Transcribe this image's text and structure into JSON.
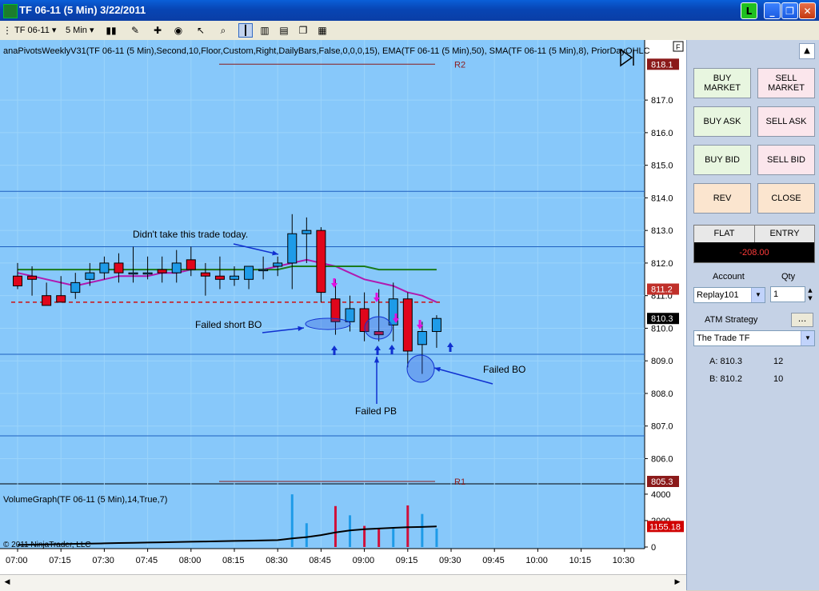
{
  "window": {
    "title": "TF 06-11 (5 Min)  3/22/2011",
    "minimize": "_",
    "restore": "❐",
    "close": "✕",
    "status_btn": "L"
  },
  "toolbar": {
    "instrument": "TF 06-11",
    "interval": "5 Min"
  },
  "chart": {
    "indicator_text": "anaPivotsWeeklyV31(TF 06-11 (5 Min),Second,10,Floor,Custom,Right,DailyBars,False,0,0,0,15), EMA(TF 06-11 (5 Min),50), SMA(TF 06-11 (5 Min),8), PriorDayOHLC",
    "volume_label": "VolumeGraph(TF 06-11 (5 Min),14,True,7)",
    "copyright": "© 2011 NinjaTrader, LLC",
    "panel_flag": "F",
    "price_ticks": [
      "817.0",
      "816.0",
      "815.0",
      "814.0",
      "813.0",
      "812.0",
      "811.0",
      "810.0",
      "809.0",
      "808.0",
      "807.0",
      "806.0"
    ],
    "price_markers": [
      {
        "text": "818.1",
        "color": "#8b1a1a"
      },
      {
        "text": "811.2",
        "color": "#c0302a"
      },
      {
        "text": "810.3",
        "color": "#000000"
      },
      {
        "text": "805.3",
        "color": "#8b1a1a"
      }
    ],
    "volume_ticks": [
      "4000",
      "2000",
      "0"
    ],
    "volume_marker": "1155.18",
    "time_ticks": [
      "07:00",
      "07:15",
      "07:30",
      "07:45",
      "08:00",
      "08:15",
      "08:30",
      "08:45",
      "09:00",
      "09:15",
      "09:30",
      "09:45",
      "10:00",
      "10:15",
      "10:30"
    ],
    "pivots": [
      "R2",
      "R1"
    ],
    "annotations": [
      {
        "text": "Didn't take this trade today."
      },
      {
        "text": "Failed short BO"
      },
      {
        "text": "Failed PB"
      },
      {
        "text": "Failed BO"
      }
    ],
    "colors": {
      "background": "#87c8fa",
      "up": "#1e9be8",
      "down": "#e0061b",
      "ema": "#1a7a1a",
      "sma": "#b01ab0",
      "pivot_line": "#8b1a1a",
      "level_line": "#1e5fc0"
    }
  },
  "chart_data": {
    "type": "candlestick",
    "x": [
      "07:00",
      "07:05",
      "07:10",
      "07:15",
      "07:20",
      "07:25",
      "07:30",
      "07:35",
      "07:40",
      "07:45",
      "07:50",
      "07:55",
      "08:00",
      "08:05",
      "08:10",
      "08:15",
      "08:20",
      "08:25",
      "08:30",
      "08:35",
      "08:40",
      "08:45",
      "08:50",
      "08:55",
      "09:00",
      "09:05",
      "09:10",
      "09:15",
      "09:20",
      "09:25"
    ],
    "open": [
      811.6,
      811.6,
      811.0,
      811.0,
      811.1,
      811.5,
      811.7,
      812.0,
      811.7,
      811.7,
      811.8,
      811.7,
      812.1,
      811.7,
      811.6,
      811.5,
      811.5,
      811.8,
      811.9,
      812.0,
      812.9,
      813.0,
      810.9,
      810.2,
      810.6,
      809.9,
      810.1,
      810.9,
      809.5,
      809.9
    ],
    "high": [
      812.0,
      811.9,
      811.4,
      811.6,
      811.7,
      812.0,
      812.2,
      812.3,
      812.5,
      812.2,
      812.2,
      812.4,
      812.5,
      812.0,
      812.2,
      811.9,
      811.9,
      812.2,
      812.2,
      813.5,
      813.4,
      813.1,
      811.5,
      811.0,
      811.1,
      811.2,
      811.4,
      811.1,
      810.2,
      810.4
    ],
    "low": [
      811.2,
      811.0,
      810.7,
      810.8,
      810.9,
      811.3,
      811.5,
      811.4,
      811.4,
      811.5,
      811.4,
      811.4,
      811.6,
      811.0,
      811.2,
      811.3,
      811.2,
      811.5,
      811.6,
      811.2,
      812.0,
      810.8,
      809.8,
      809.9,
      809.6,
      809.6,
      809.6,
      808.8,
      808.6,
      809.4
    ],
    "close": [
      811.3,
      811.5,
      810.7,
      810.8,
      811.4,
      811.7,
      812.0,
      811.7,
      811.7,
      811.7,
      811.7,
      812.0,
      811.8,
      811.6,
      811.5,
      811.6,
      811.9,
      811.8,
      812.0,
      812.9,
      813.0,
      811.1,
      810.2,
      810.6,
      809.9,
      809.8,
      810.9,
      809.3,
      809.9,
      810.3
    ],
    "ema50": [
      811.8,
      811.8,
      811.8,
      811.8,
      811.8,
      811.8,
      811.8,
      811.8,
      811.8,
      811.8,
      811.8,
      811.8,
      811.8,
      811.8,
      811.8,
      811.8,
      811.8,
      811.8,
      811.8,
      811.9,
      811.9,
      811.9,
      811.9,
      811.9,
      811.9,
      811.8,
      811.8,
      811.8,
      811.8,
      811.8
    ],
    "sma8": [
      811.7,
      811.6,
      811.5,
      811.4,
      811.3,
      811.4,
      811.5,
      811.6,
      811.6,
      811.6,
      811.7,
      811.7,
      811.8,
      811.8,
      811.8,
      811.8,
      811.8,
      811.8,
      811.9,
      812.0,
      812.1,
      812.0,
      811.9,
      811.7,
      811.5,
      811.4,
      811.3,
      811.1,
      811.0,
      810.8
    ],
    "volume": [
      0,
      0,
      0,
      0,
      0,
      0,
      0,
      0,
      0,
      0,
      0,
      0,
      0,
      0,
      0,
      0,
      0,
      0,
      0,
      3990,
      1800,
      0,
      3100,
      2400,
      1600,
      1400,
      1500,
      3150,
      2500,
      1400
    ],
    "volume_avg": [
      160,
      180,
      200,
      220,
      240,
      260,
      280,
      300,
      320,
      340,
      360,
      380,
      400,
      420,
      440,
      460,
      480,
      500,
      520,
      650,
      750,
      900,
      1100,
      1250,
      1350,
      1400,
      1450,
      1500,
      1520,
      1555
    ],
    "ylim": [
      805.3,
      818.5
    ],
    "volume_ylim": [
      0,
      4600
    ],
    "pivot_levels": [
      {
        "name": "R2",
        "value": 818.1
      },
      {
        "name": "R1",
        "value": 805.3
      }
    ],
    "level_lines": [
      814.2,
      812.5,
      809.2,
      806.7
    ],
    "prior_close": 810.8,
    "grid": true
  },
  "panel": {
    "buttons": [
      {
        "label": "BUY\nMARKET",
        "kind": "buy"
      },
      {
        "label": "SELL\nMARKET",
        "kind": "sell"
      },
      {
        "label": "BUY ASK",
        "kind": "buy"
      },
      {
        "label": "SELL ASK",
        "kind": "sell"
      },
      {
        "label": "BUY BID",
        "kind": "buy"
      },
      {
        "label": "SELL BID",
        "kind": "sell"
      },
      {
        "label": "REV",
        "kind": "neutral"
      },
      {
        "label": "CLOSE",
        "kind": "neutral"
      }
    ],
    "position_label": "FLAT",
    "entry_label": "ENTRY",
    "pnl": "-208.00",
    "account_label": "Account",
    "qty_label": "Qty",
    "account_value": "Replay101",
    "qty_value": "1",
    "atm_label": "ATM Strategy",
    "atm_more": "...",
    "atm_value": "The Trade TF",
    "ask_label": "A: 810.3",
    "ask_size": "12",
    "bid_label": "B: 810.2",
    "bid_size": "10"
  }
}
